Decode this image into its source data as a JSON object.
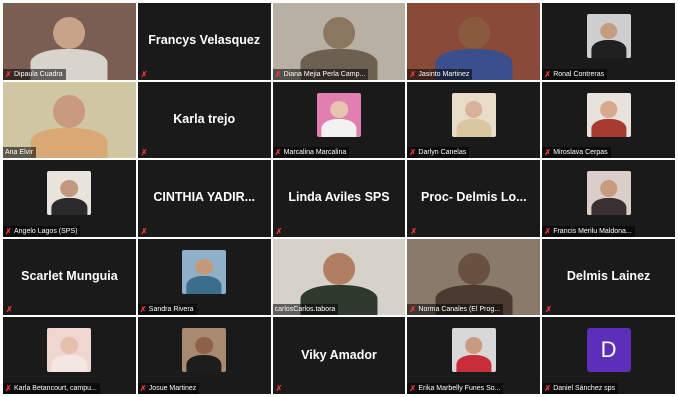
{
  "participants": [
    {
      "name": "Dipaula Cuadra",
      "muted": true,
      "kind": "video",
      "bg": "#7a5e52",
      "skin": "#c9a389",
      "shirt": "#d9d3cd"
    },
    {
      "name": "Francys Velasquez",
      "muted": true,
      "kind": "name"
    },
    {
      "name": "Diana Mejia Perla Camp...",
      "muted": true,
      "kind": "video",
      "bg": "#b8b0a5",
      "skin": "#8b7760",
      "shirt": "#6c6150"
    },
    {
      "name": "Jasinto Martinez",
      "muted": true,
      "kind": "video",
      "bg": "#8a4a3a",
      "skin": "#8a5a3c",
      "shirt": "#3a4f8c"
    },
    {
      "name": "Ronal Contreras",
      "muted": true,
      "kind": "photo",
      "bg": "#cfcfcf",
      "skin": "#c49c80",
      "shirt": "#202020"
    },
    {
      "name": "Ana Elvir",
      "muted": false,
      "kind": "video",
      "active": true,
      "bg": "#cfc6a4",
      "skin": "#c99a7e",
      "shirt": "#d9a873"
    },
    {
      "name": "Karla trejo",
      "muted": true,
      "kind": "name"
    },
    {
      "name": "Marcalina Marcalina",
      "muted": true,
      "kind": "photo",
      "bg": "#e07fb0",
      "skin": "#e8c3b0",
      "shirt": "#f2f2f2"
    },
    {
      "name": "Darlyn Canelas",
      "muted": true,
      "kind": "photo",
      "bg": "#e6dcc8",
      "skin": "#d8b299",
      "shirt": "#d9c7a0"
    },
    {
      "name": "Miroslava Cerpas",
      "muted": true,
      "kind": "photo",
      "bg": "#e8e2dc",
      "skin": "#d8a88f",
      "shirt": "#a83a2f"
    },
    {
      "name": "Angelo Lagos (SPS)",
      "muted": true,
      "kind": "photo",
      "bg": "#e8e4dc",
      "skin": "#c2997e",
      "shirt": "#2a2a2a"
    },
    {
      "name": "CINTHIA YADIR...",
      "muted": true,
      "kind": "name"
    },
    {
      "name": "Linda Aviles SPS",
      "muted": true,
      "kind": "name"
    },
    {
      "name": "Proc- Delmis Lo...",
      "muted": true,
      "kind": "name"
    },
    {
      "name": "Francis Merilu Maldona...",
      "muted": true,
      "kind": "photo",
      "bg": "#d9cfc8",
      "skin": "#c89b7f",
      "shirt": "#3a3030"
    },
    {
      "name": "Scarlet Munguia",
      "muted": true,
      "kind": "name"
    },
    {
      "name": "Sandra Rivera",
      "muted": true,
      "kind": "photo",
      "bg": "#8fb0c8",
      "skin": "#c49a7c",
      "shirt": "#3b6e8c"
    },
    {
      "name": "carlosCarlos.tabora",
      "muted": false,
      "kind": "video",
      "bg": "#d7d2c9",
      "skin": "#b07e60",
      "shirt": "#2f3a2f"
    },
    {
      "name": "Norma Canales (El Prog...",
      "muted": true,
      "kind": "video",
      "bg": "#8a7a6a",
      "skin": "#6a5040",
      "shirt": "#4a3a30"
    },
    {
      "name": "Delmis Lainez",
      "muted": true,
      "kind": "name"
    },
    {
      "name": "Karla Betancourt, campu...",
      "muted": true,
      "kind": "photo",
      "bg": "#f0d6d0",
      "skin": "#e6c0ad",
      "shirt": "#f4e6e0"
    },
    {
      "name": "Josue Martinez",
      "muted": true,
      "kind": "photo",
      "bg": "#a88a70",
      "skin": "#8e6248",
      "shirt": "#1d1d1d"
    },
    {
      "name": "Viky Amador",
      "muted": true,
      "kind": "name"
    },
    {
      "name": "Erika Marbelly Funes So...",
      "muted": true,
      "kind": "photo",
      "bg": "#d8d8d8",
      "skin": "#c89a80",
      "shirt": "#c82e3a"
    },
    {
      "name": "Daniel Sánchez sps",
      "muted": true,
      "kind": "letter",
      "letter": "D",
      "bg": "#5d2fb8"
    }
  ]
}
